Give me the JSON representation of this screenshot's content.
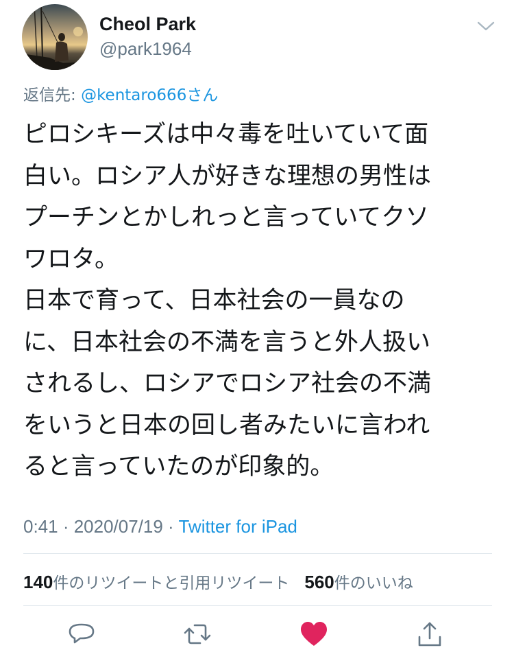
{
  "tweet": {
    "author": {
      "display_name": "Cheol Park",
      "handle": "@park1964"
    },
    "reply_to": {
      "prefix": "返信先: ",
      "mention": "@kentaro666",
      "suffix": "さん"
    },
    "text_lines": [
      "ピロシキーズは中々毒を吐いていて面",
      "白い。ロシア人が好きな理想の男性は",
      "プーチンとかしれっと言っていてクソ",
      "ワロタ。",
      "日本で育って、日本社会の一員なの",
      "に、日本社会の不満を言うと外人扱い",
      "されるし、ロシアでロシア社会の不満",
      "をいうと日本の回し者みたいに言われ",
      "ると言っていたのが印象的。"
    ],
    "time": "0:41 · 2020/07/19 · ",
    "source": "Twitter for iPad",
    "stats": {
      "retweets_count": "140",
      "retweets_label": "件のリツイートと引用リツイート",
      "likes_count": "560",
      "likes_label": "件のいいね"
    },
    "liked": true
  },
  "colors": {
    "text": "#14171a",
    "secondary": "#657786",
    "link": "#1b95e0",
    "like": "#e0245e",
    "divider": "#e1e8ed"
  },
  "icons": {
    "caret": "chevron-down-icon",
    "reply": "reply-icon",
    "retweet": "retweet-icon",
    "like": "heart-icon",
    "share": "share-icon"
  }
}
